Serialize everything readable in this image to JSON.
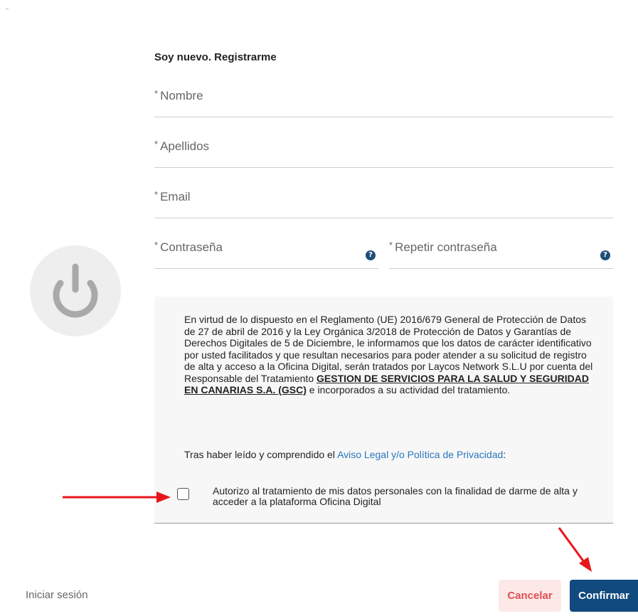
{
  "form": {
    "title": "Soy nuevo. Registrarme",
    "required_mark": "*",
    "fields": {
      "nombre": "Nombre",
      "apellidos": "Apellidos",
      "email": "Email",
      "password": "Contraseña",
      "password_repeat": "Repetir contraseña"
    },
    "help_icon": "?"
  },
  "consent": {
    "legal_part1": "En virtud de lo dispuesto en el Reglamento (UE) 2016/679 General de Protección de Datos de 27 de abril de 2016 y la Ley Orgánica 3/2018 de Protección de Datos y Garantías de Derechos Digitales de 5 de Diciembre, le informamos que los datos de carácter identificativo por usted facilitados y que resultan necesarios para poder atender a su solicitud de registro de alta y acceso a la Oficina Digital, serán tratados por Laycos Network S.L.U por cuenta del Responsable del Tratamiento",
    "legal_bold": "GESTION DE SERVICIOS PARA LA SALUD Y SEGURIDAD EN CANARIAS S.A. (GSC)",
    "legal_part2": "e incorporados a su actividad del tratamiento.",
    "read_prefix": "Tras haber leído y comprendido el",
    "privacy_link": "Aviso Legal y/o Política de Privacidad",
    "read_suffix": ":",
    "checkbox_label": "Autorizo al tratamiento de mis datos personales con la finalidad de darme de alta y acceder a la plataforma Oficina Digital",
    "checked": false
  },
  "footer": {
    "login_link": "Iniciar sesión",
    "cancel_label": "Cancelar",
    "confirm_label": "Confirmar"
  },
  "icons": {
    "power": "power-icon",
    "help": "help-circle-icon",
    "arrow": "red-arrow"
  },
  "colors": {
    "primary": "#114a7e",
    "cancel_bg": "#fde8e8",
    "cancel_text": "#e05050",
    "link": "#2a77bd",
    "arrow": "#e8161b"
  }
}
